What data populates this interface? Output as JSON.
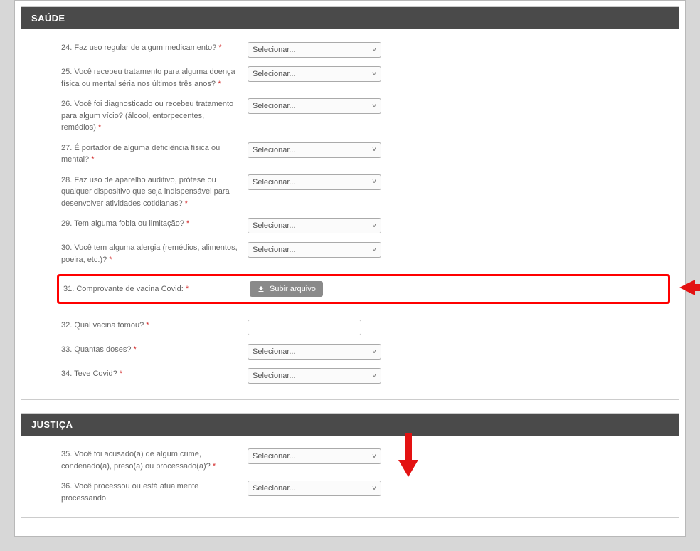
{
  "select_placeholder": "Selecionar...",
  "sections": {
    "saude": {
      "title": "SAÚDE",
      "q24": "24. Faz uso regular de algum medicamento?",
      "q25": "25. Você recebeu tratamento para alguma doença física ou mental séria nos últimos três anos?",
      "q26": "26. Você foi diagnosticado ou recebeu tratamento para algum vício? (álcool, entorpecentes, remédios)",
      "q27": "27. É portador de alguma deficiência física ou mental?",
      "q28": "28. Faz uso de aparelho auditivo, prótese ou qualquer dispositivo que seja indispensável para desenvolver atividades cotidianas?",
      "q29": "29. Tem alguma fobia ou limitação?",
      "q30": "30. Você tem alguma alergia (remédios, alimentos, poeira, etc.)?",
      "q31": "31. Comprovante de vacina Covid:",
      "q32": "32. Qual vacina tomou?",
      "q33": "33. Quantas doses?",
      "q34": "34. Teve Covid?"
    },
    "justica": {
      "title": "JUSTIÇA",
      "q35": "35. Você foi acusado(a) de algum crime, condenado(a), preso(a) ou processado(a)?",
      "q36": "36. Você processou ou está atualmente processando"
    }
  },
  "buttons": {
    "upload": "Subir arquivo"
  }
}
